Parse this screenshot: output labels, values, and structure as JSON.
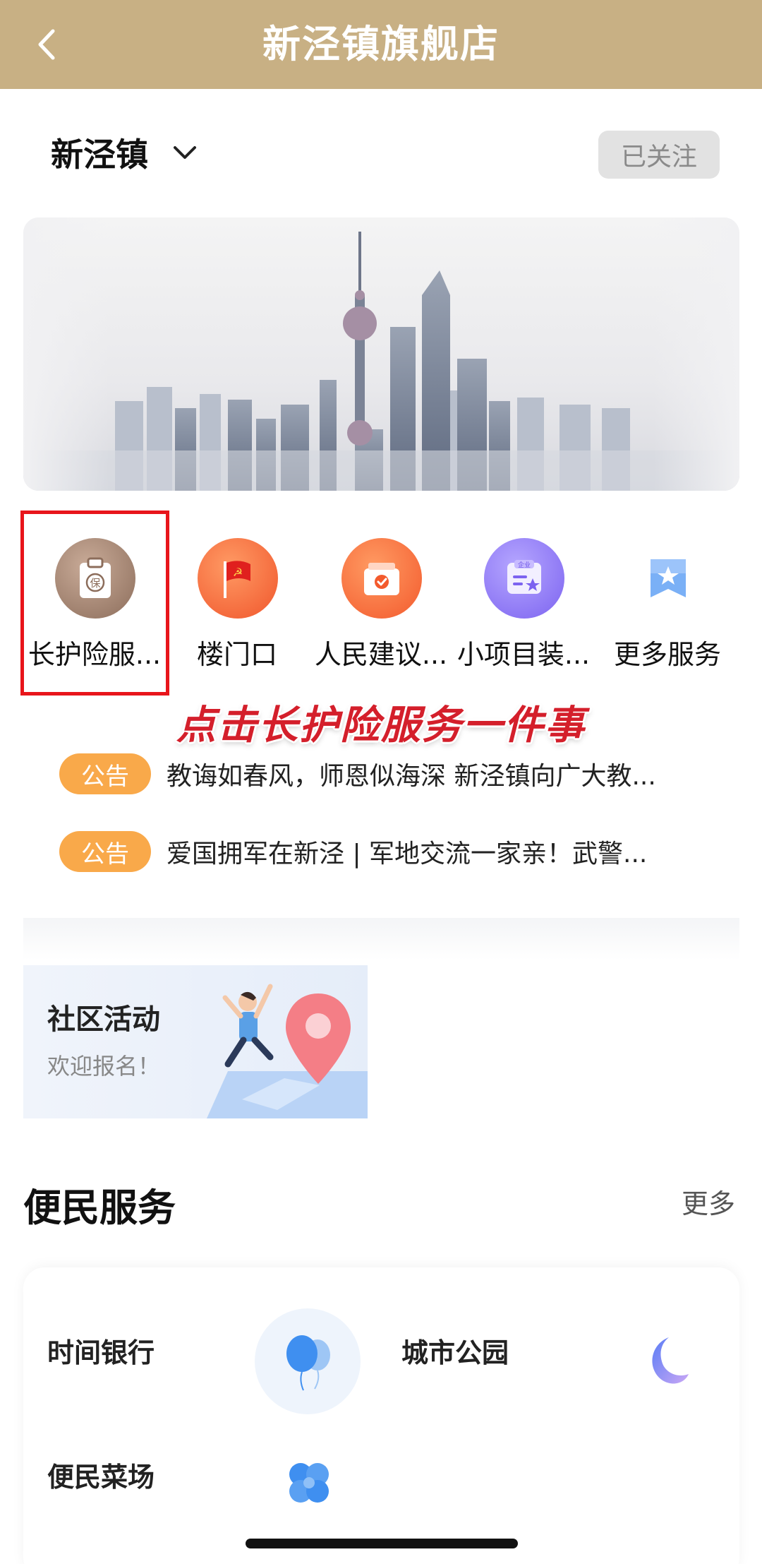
{
  "header": {
    "title": "新泾镇旗舰店",
    "back_icon": "chevron-left-icon"
  },
  "town": {
    "name": "新泾镇",
    "follow_label": "已关注"
  },
  "services": [
    {
      "label": "长护险服...",
      "icon": "insurance-clipboard-icon",
      "color": "#9a7b68"
    },
    {
      "label": "楼门口",
      "icon": "party-flag-icon",
      "color": "#f46a3a"
    },
    {
      "label": "人民建议...",
      "icon": "suggestion-box-icon",
      "color": "#f5683a"
    },
    {
      "label": "小项目装...",
      "icon": "enterprise-card-icon",
      "color": "#8a74f4"
    },
    {
      "label": "更多服务",
      "icon": "star-bookmark-icon",
      "color": "#6ea6f3"
    }
  ],
  "promo_caption": "点击长护险服务一件事",
  "notices": [
    {
      "badge": "公告",
      "text": "教诲如春风，师恩似海深 新泾镇向广大教..."
    },
    {
      "badge": "公告",
      "text": "爱国拥军在新泾 | 军地交流一家亲！武警..."
    }
  ],
  "activity": {
    "title": "社区活动",
    "subtitle": "欢迎报名！"
  },
  "convenience": {
    "title": "便民服务",
    "more_label": "更多",
    "items": [
      {
        "label": "时间银行",
        "icon": "balloon-icon"
      },
      {
        "label": "城市公园",
        "icon": "moon-icon"
      },
      {
        "label": "便民菜场",
        "icon": "clover-icon"
      }
    ]
  },
  "accent_colors": {
    "topbar": "#c8b084",
    "notice_badge": "#f9a94a",
    "highlight": "#e8151b"
  }
}
